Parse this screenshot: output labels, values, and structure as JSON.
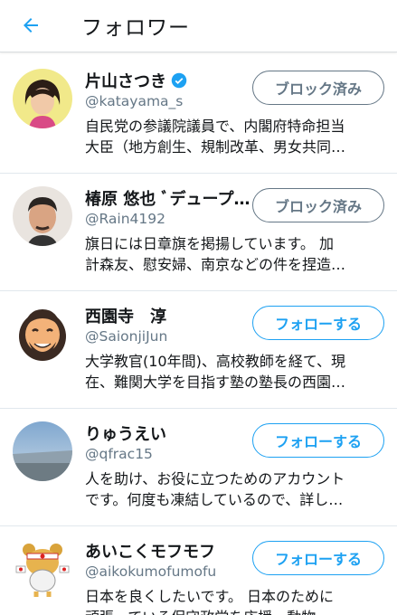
{
  "header": {
    "title": "フォロワー",
    "back_icon": "arrow-left-icon"
  },
  "colors": {
    "accent": "#1da1f2",
    "muted": "#657786",
    "text": "#14171a"
  },
  "users": [
    {
      "name": "片山さつき",
      "verified": true,
      "handle": "@katayama_s",
      "bio_line1": "自民党の参議院議員で、内閣府特命担当",
      "bio_line2": "大臣（地方創生、規制改革、男女共同…",
      "button": "ブロック済み",
      "button_state": "blocked"
    },
    {
      "name": "椿原 悠也 ﾞデュープ…",
      "verified": false,
      "handle": "@Rain4192",
      "bio_line1": "旗日には日章旗を掲揚しています。 加",
      "bio_line2": "計森友、慰安婦、南京などの件を捏造…",
      "button": "ブロック済み",
      "button_state": "blocked"
    },
    {
      "name": "西園寺　淳",
      "verified": false,
      "handle": "@SaionjiJun",
      "bio_line1": "大学教官(10年間)、高校教師を経て、現",
      "bio_line2": "在、難関大学を目指す塾の塾長の西園…",
      "button": "フォローする",
      "button_state": "follow"
    },
    {
      "name": "りゅうえい",
      "verified": false,
      "handle": "@qfrac15",
      "bio_line1": "人を助け、お役に立つためのアカウント",
      "bio_line2": "です。何度も凍結しているので、詳し…",
      "button": "フォローする",
      "button_state": "follow"
    },
    {
      "name": "あいこくモフモフ",
      "verified": false,
      "handle": "@aikokumofumofu",
      "bio_line1": "日本を良くしたいです。 日本のために",
      "bio_line2": "頑張っている保守政党を応援。動物…",
      "button": "フォローする",
      "button_state": "follow"
    }
  ]
}
